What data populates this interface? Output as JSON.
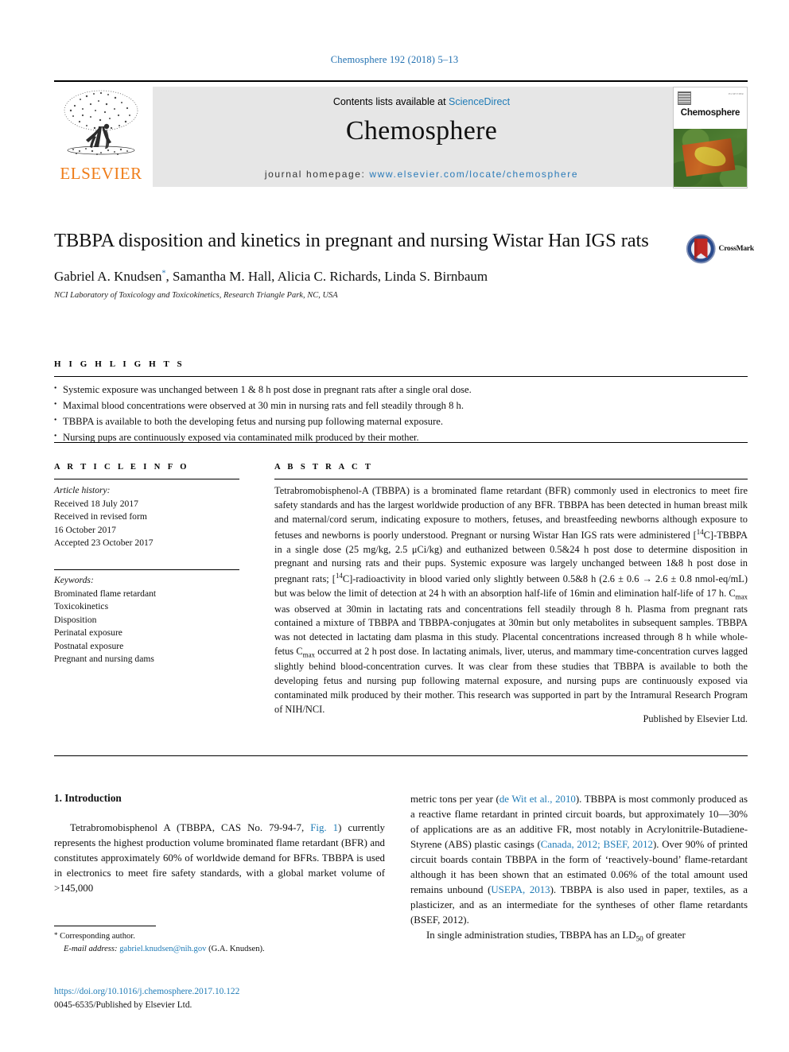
{
  "running_head": "Chemosphere 192 (2018) 5–13",
  "masthead": {
    "publisher": "ELSEVIER",
    "contents_prefix": "Contents lists available at ",
    "contents_link": "ScienceDirect",
    "journal_title": "Chemosphere",
    "homepage_prefix": "journal homepage: ",
    "homepage_url": "www.elsevier.com/locate/chemosphere",
    "cover_name": "Chemosphere",
    "cover_corner_text": "ELSEVIER"
  },
  "article": {
    "title": "TBBPA disposition and kinetics in pregnant and nursing Wistar Han IGS rats",
    "authors": "Gabriel A. Knudsen*, Samantha M. Hall, Alicia C. Richards, Linda S. Birnbaum",
    "affiliation": "NCI Laboratory of Toxicology and Toxicokinetics, Research Triangle Park, NC, USA",
    "crossmark_label": "CrossMark"
  },
  "highlights": {
    "heading": "H I G H L I G H T S",
    "items": [
      "Systemic exposure was unchanged between 1 & 8 h post dose in pregnant rats after a single oral dose.",
      "Maximal blood concentrations were observed at 30 min in nursing rats and fell steadily through 8 h.",
      "TBBPA is available to both the developing fetus and nursing pup following maternal exposure.",
      "Nursing pups are continuously exposed via contaminated milk produced by their mother."
    ]
  },
  "article_info": {
    "heading": "A R T I C L E  I N F O",
    "history_label": "Article history:",
    "history": [
      "Received 18 July 2017",
      "Received in revised form",
      "16 October 2017",
      "Accepted 23 October 2017"
    ],
    "keywords_label": "Keywords:",
    "keywords": [
      "Brominated flame retardant",
      "Toxicokinetics",
      "Disposition",
      "Perinatal exposure",
      "Postnatal exposure",
      "Pregnant and nursing dams"
    ]
  },
  "abstract": {
    "heading": "A B S T R A C T",
    "text": "Tetrabromobisphenol-A (TBBPA) is a brominated flame retardant (BFR) commonly used in electronics to meet fire safety standards and has the largest worldwide production of any BFR. TBBPA has been detected in human breast milk and maternal/cord serum, indicating exposure to mothers, fetuses, and breastfeeding newborns although exposure to fetuses and newborns is poorly understood. Pregnant or nursing Wistar Han IGS rats were administered [14C]-TBBPA in a single dose (25 mg/kg, 2.5 μCi/kg) and euthanized between 0.5&24 h post dose to determine disposition in pregnant and nursing rats and their pups. Systemic exposure was largely unchanged between 1&8 h post dose in pregnant rats; [14C]-radioactivity in blood varied only slightly between 0.5&8 h (2.6 ± 0.6 → 2.6 ± 0.8 nmol-eq/mL) but was below the limit of detection at 24 h with an absorption half-life of 16min and elimination half-life of 17 h. Cmax was observed at 30min in lactating rats and concentrations fell steadily through 8 h. Plasma from pregnant rats contained a mixture of TBBPA and TBBPA-conjugates at 30min but only metabolites in subsequent samples. TBBPA was not detected in lactating dam plasma in this study. Placental concentrations increased through 8 h while whole-fetus Cmax occurred at 2 h post dose. In lactating animals, liver, uterus, and mammary time-concentration curves lagged slightly behind blood-concentration curves. It was clear from these studies that TBBPA is available to both the developing fetus and nursing pup following maternal exposure, and nursing pups are continuously exposed via contaminated milk produced by their mother. This research was supported in part by the Intramural Research Program of NIH/NCI.",
    "published_by": "Published by Elsevier Ltd."
  },
  "body": {
    "section_number_title": "1. Introduction",
    "left_column": "Tetrabromobisphenol A (TBBPA, CAS No. 79-94-7, Fig. 1) currently represents the highest production volume brominated flame retardant (BFR) and constitutes approximately 60% of worldwide demand for BFRs. TBBPA is used in electronics to meet fire safety standards, with a global market volume of >145,000",
    "left_column_link": "Fig. 1",
    "right_column_para1": "metric tons per year (de Wit et al., 2010). TBBPA is most commonly produced as a reactive flame retardant in printed circuit boards, but approximately 10—30% of applications are as an additive FR, most notably in Acrylonitrile-Butadiene-Styrene (ABS) plastic casings (Canada, 2012; BSEF, 2012). Over 90% of printed circuit boards contain TBBPA in the form of ‘reactively-bound’ flame-retardant although it has been shown that an estimated 0.06% of the total amount used remains unbound (USEPA, 2013). TBBPA is also used in paper, textiles, as a plasticizer, and as an intermediate for the syntheses of other flame retardants (BSEF, 2012).",
    "right_column_para2": "In single administration studies, TBBPA has an LD50 of greater",
    "citations": [
      "de Wit et al., 2010",
      "Canada, 2012; BSEF, 2012",
      "USEPA, 2013",
      "BSEF, 2012"
    ]
  },
  "footer": {
    "corresponding_label": "Corresponding author.",
    "email_label": "E-mail address:",
    "email": "gabriel.knudsen@nih.gov",
    "email_owner": "(G.A. Knudsen).",
    "doi": "https://doi.org/10.1016/j.chemosphere.2017.10.122",
    "issn_line": "0045-6535/Published by Elsevier Ltd."
  },
  "colors": {
    "link_blue": "#1f7bb6",
    "elsevier_orange": "#ef7d1a",
    "band_gray": "#e6e6e6"
  }
}
